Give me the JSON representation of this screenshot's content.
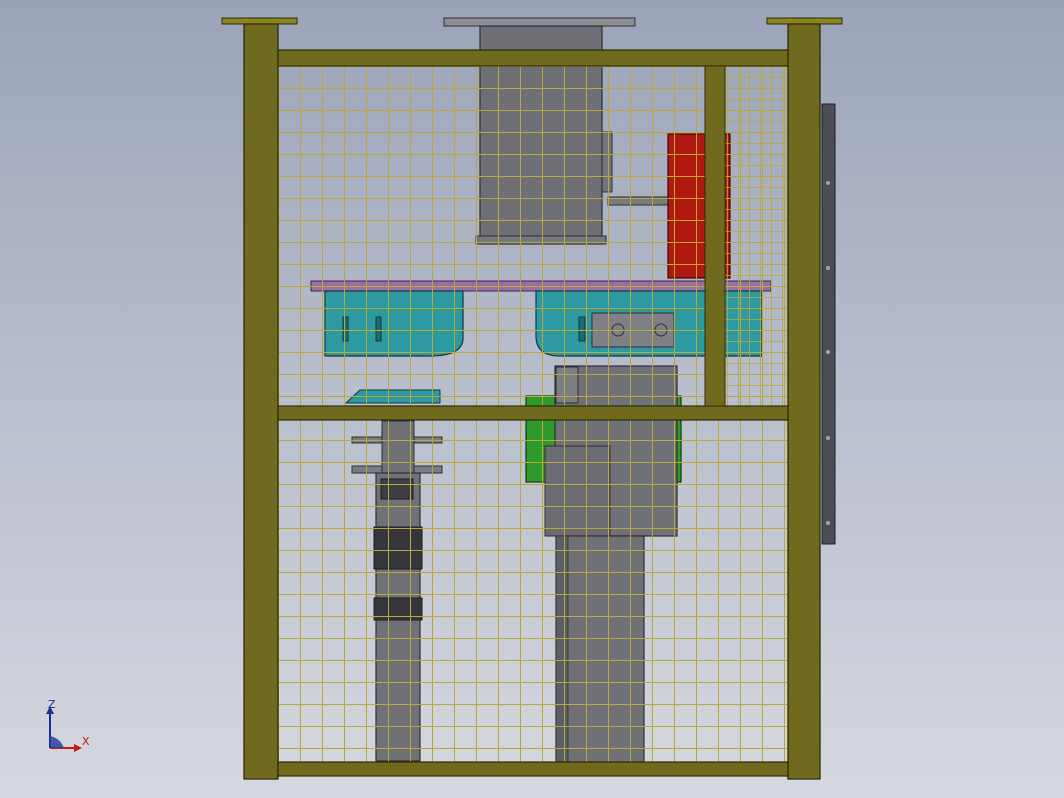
{
  "viewport": {
    "background_top": "#9aa3b8",
    "background_bottom": "#d6d8de"
  },
  "colors": {
    "frame": "#6f6a1d",
    "frame_edge": "#2f2c08",
    "mesh": "#b8a93a",
    "shaft": "#6f7177",
    "shaft_dark": "#3c3e44",
    "shelf": "#9a6fa6",
    "teal": "#2c9aa0",
    "green": "#2f9a2c",
    "red": "#b01810",
    "side_rail": "#4a4d55"
  },
  "triad": {
    "z_label": "Z",
    "x_label": "X",
    "z_color": "#1a2f9a",
    "x_color": "#c81818"
  }
}
